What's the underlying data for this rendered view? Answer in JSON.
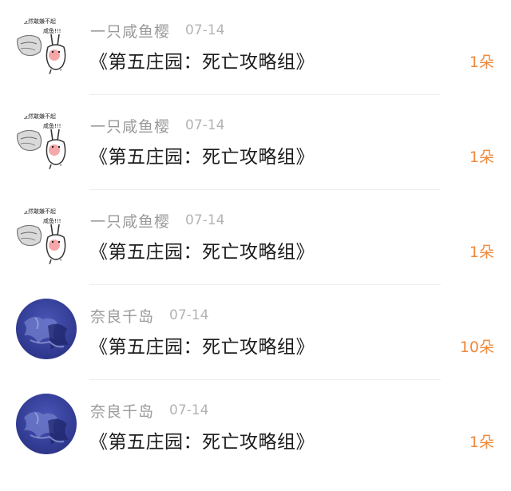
{
  "accent_color": "#f08a3c",
  "rows": [
    {
      "username": "一只咸鱼樱",
      "date": "07-14",
      "title": "《第五庄园：死亡攻略组》",
      "count": "1朵",
      "avatar": "meme-sticker",
      "avatar_text": [
        "虽然敢嫌不起",
        "咸鱼!!!"
      ]
    },
    {
      "username": "一只咸鱼樱",
      "date": "07-14",
      "title": "《第五庄园：死亡攻略组》",
      "count": "1朵",
      "avatar": "meme-sticker",
      "avatar_text": [
        "虽然敢嫌不起",
        "咸鱼!!!"
      ]
    },
    {
      "username": "一只咸鱼樱",
      "date": "07-14",
      "title": "《第五庄园：死亡攻略组》",
      "count": "1朵",
      "avatar": "meme-sticker",
      "avatar_text": [
        "虽然敢嫌不起",
        "咸鱼!!!"
      ]
    },
    {
      "username": "奈良千岛",
      "date": "07-14",
      "title": "《第五庄园：死亡攻略组》",
      "count": "10朵",
      "avatar": "blue-artwork"
    },
    {
      "username": "奈良千岛",
      "date": "07-14",
      "title": "《第五庄园：死亡攻略组》",
      "count": "1朵",
      "avatar": "blue-artwork"
    }
  ]
}
